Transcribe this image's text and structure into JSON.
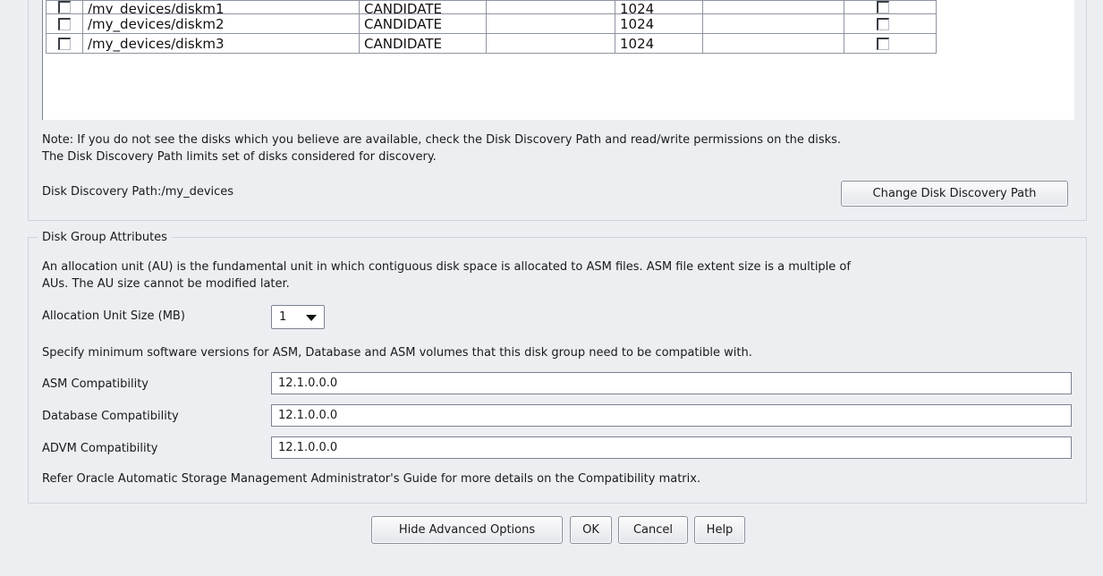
{
  "disk_table": {
    "rows": [
      {
        "selected": false,
        "path": "/my_devices/diskm1",
        "status": "CANDIDATE",
        "col4": "",
        "size": "1024",
        "col6": "",
        "quorum": false
      },
      {
        "selected": false,
        "path": "/my_devices/diskm2",
        "status": "CANDIDATE",
        "col4": "",
        "size": "1024",
        "col6": "",
        "quorum": false
      },
      {
        "selected": false,
        "path": "/my_devices/diskm3",
        "status": "CANDIDATE",
        "col4": "",
        "size": "1024",
        "col6": "",
        "quorum": false
      }
    ]
  },
  "discovery": {
    "note_line1": "Note: If you do not see the disks which you believe are available, check the Disk Discovery Path and read/write permissions on the disks.",
    "note_line2": "The Disk Discovery Path limits set of disks considered for discovery.",
    "path_label": "Disk Discovery Path:/my_devices",
    "change_button": "Change Disk Discovery Path"
  },
  "attributes": {
    "legend": "Disk Group Attributes",
    "au_desc_line1": "An allocation unit (AU) is the fundamental unit in which contiguous disk space is allocated to ASM files. ASM file extent size is a multiple of",
    "au_desc_line2": "AUs. The AU size cannot be modified later.",
    "au_label": "Allocation Unit Size (MB)",
    "au_value": "1",
    "compat_desc": "Specify minimum software versions for ASM, Database and ASM volumes that this disk group need to be compatible with.",
    "asm_label": "ASM Compatibility",
    "asm_value": "12.1.0.0.0",
    "db_label": "Database Compatibility",
    "db_value": "12.1.0.0.0",
    "advm_label": "ADVM Compatibility",
    "advm_value": "12.1.0.0.0",
    "refer_note": "Refer Oracle Automatic Storage Management Administrator's Guide for more details on the Compatibility matrix."
  },
  "footer": {
    "hide_advanced": "Hide Advanced Options",
    "ok": "OK",
    "cancel": "Cancel",
    "help": "Help"
  }
}
